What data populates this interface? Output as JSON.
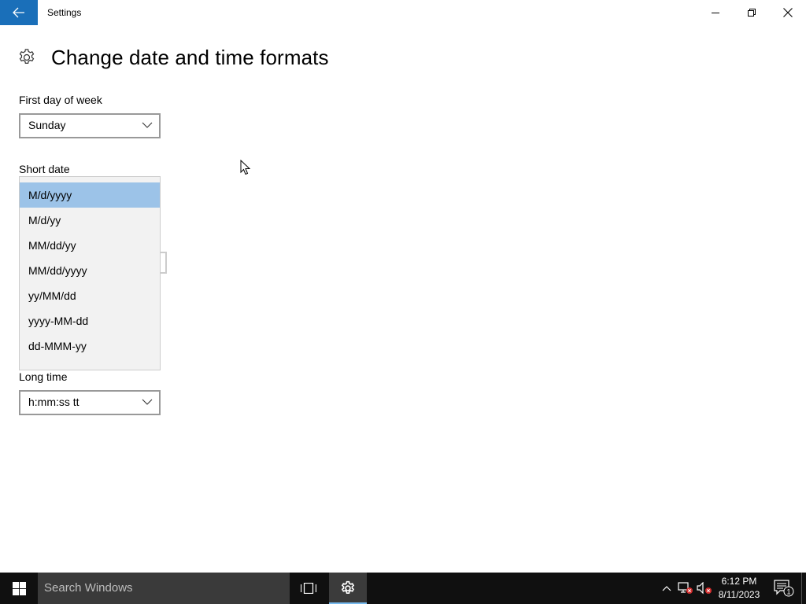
{
  "window": {
    "title": "Settings",
    "back_icon": "back-arrow-icon",
    "controls": {
      "minimize_icon": "minimize-icon",
      "maximize_icon": "restore-icon",
      "close_icon": "close-icon"
    }
  },
  "page": {
    "title": "Change date and time formats",
    "header_icon": "gear-icon"
  },
  "fields": {
    "first_day": {
      "label": "First day of week",
      "value": "Sunday"
    },
    "short_date": {
      "label": "Short date",
      "options": [
        "M/d/yyyy",
        "M/d/yy",
        "MM/dd/yy",
        "MM/dd/yyyy",
        "yy/MM/dd",
        "yyyy-MM-dd",
        "dd-MMM-yy"
      ],
      "selected": "M/d/yyyy"
    },
    "long_time": {
      "label": "Long time",
      "value": "h:mm:ss tt"
    }
  },
  "taskbar": {
    "start_icon": "windows-logo-icon",
    "search_placeholder": "Search Windows",
    "task_view_icon": "task-view-icon",
    "settings_app_icon": "gear-icon",
    "time": "6:12 PM",
    "date": "8/11/2023",
    "notification_count": "1"
  },
  "colors": {
    "accent": "#1a6fb9",
    "selection": "#9cc3e8",
    "taskbar": "#101010"
  }
}
